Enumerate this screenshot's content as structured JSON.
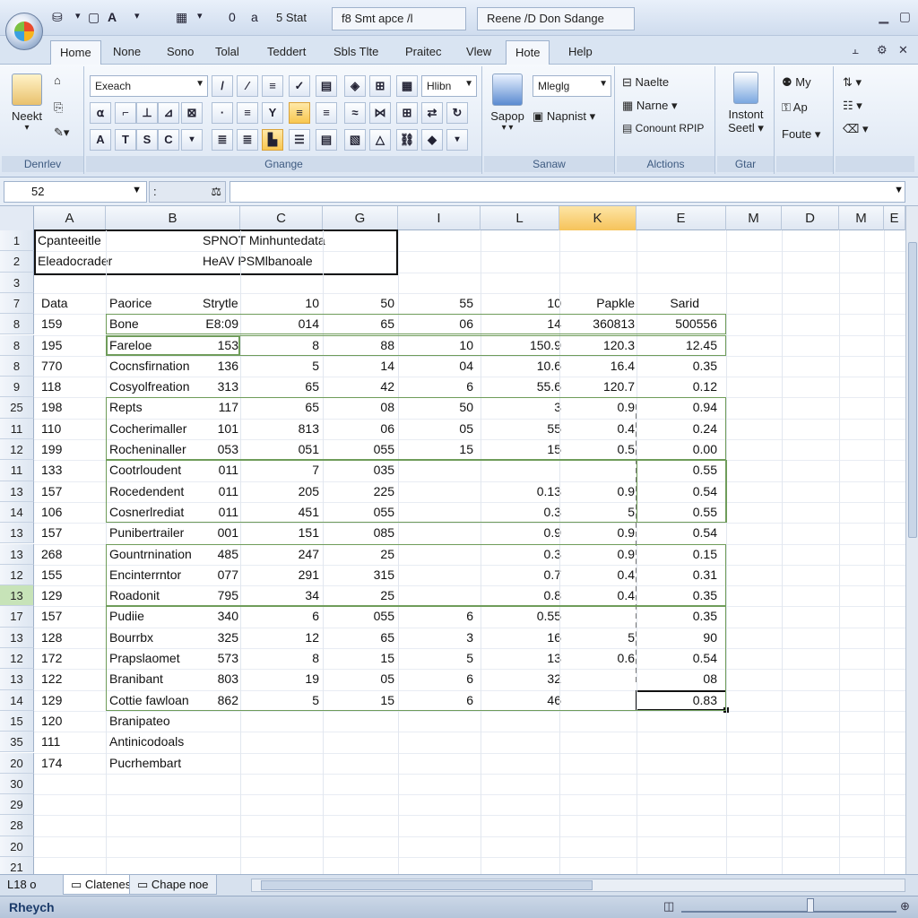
{
  "title_bar": {
    "quick_access": [
      "⇱",
      "A",
      "0",
      "a"
    ],
    "doc_title_1": "5 Stat",
    "doc_title_2": "f8 Smt apce /l",
    "doc_title_3": "Reene /D Don Sdange"
  },
  "tabs": [
    "Home",
    "None",
    "Sono",
    "Tolal",
    "Teddert",
    "Sbls Tlte",
    "Praitec",
    "Vlew",
    "Hote",
    "Help"
  ],
  "active_tab": "Home",
  "ribbon": {
    "clipboard": {
      "paste_label": "Neekt",
      "group_label": "Denrlev"
    },
    "font": {
      "font_name": "Exeach",
      "style_name": "Hlibn",
      "group_label": "Gnange"
    },
    "styles": {
      "combo": "Mleglg",
      "big_label": "Sapop",
      "napnist": "Napnist",
      "group_label": "Sanaw"
    },
    "actions": {
      "items": [
        "Naelte",
        "Narne",
        "Conount RPIP"
      ],
      "group_label": "Alctions"
    },
    "insert": {
      "label_1": "Instont",
      "label_2": "Seetl",
      "group_label": "Gtar"
    },
    "misc": {
      "items": [
        "My",
        "Ap",
        "Foute"
      ]
    }
  },
  "formula_bar": {
    "name_box": "52",
    "formula": ""
  },
  "columns": [
    "A",
    "B",
    "C",
    "G",
    "I",
    "L",
    "K",
    "E",
    "M",
    "D",
    "M",
    "E"
  ],
  "selected_column": "K",
  "row_numbers": [
    "1",
    "2",
    "3",
    "7",
    "8",
    "8",
    "8",
    "9",
    "25",
    "11",
    "12",
    "11",
    "13",
    "14",
    "13",
    "13",
    "12",
    "13",
    "17",
    "13",
    "12",
    "13",
    "14",
    "15",
    "35",
    "20",
    "30",
    "29",
    "28",
    "20",
    "21"
  ],
  "selected_row_index": 17,
  "header_cells": {
    "r1_a": "Cpanteeitle",
    "r1_c": "SPNOT Minhuntedata",
    "r2_a": "Eleadocrader",
    "r2_c": "HeAV PSMlbanoale"
  },
  "table_header": [
    "Data",
    "Paorice",
    "Strytle",
    "10",
    "50",
    "55",
    "10",
    "Papkle",
    "Sarid"
  ],
  "rows": [
    [
      "159",
      "Bone",
      "E8:09",
      "014",
      "65",
      "06",
      "14",
      "360813",
      "500556"
    ],
    [
      "195",
      "Fareloe",
      "153",
      "8",
      "88",
      "10",
      "150.9",
      "120.3",
      "12.45"
    ],
    [
      "770",
      "Cocnsfirnation",
      "136",
      "5",
      "14",
      "04",
      "10.6",
      "16.4",
      "0.35"
    ],
    [
      "118",
      "Cosyolfreation",
      "313",
      "65",
      "42",
      "6",
      "55.6",
      "120.7",
      "0.12"
    ],
    [
      "198",
      "Repts",
      "117",
      "65",
      "08",
      "50",
      "3",
      "0.9",
      "0.94"
    ],
    [
      "110",
      "Cocherimaller",
      "101",
      "813",
      "06",
      "05",
      "55",
      "0.4",
      "0.24"
    ],
    [
      "199",
      "Rocheninaller",
      "053",
      "051",
      "055",
      "15",
      "15",
      "0.5",
      "0.00"
    ],
    [
      "133",
      "Cootrloudent",
      "011",
      "7",
      "035",
      "",
      "",
      "",
      "0.55"
    ],
    [
      "157",
      "Rocedendent",
      "011",
      "205",
      "225",
      "",
      "0.13",
      "0.9",
      "0.54"
    ],
    [
      "106",
      "Cosnerlrediat",
      "011",
      "451",
      "055",
      "",
      "0.3",
      "5",
      "0.55"
    ],
    [
      "157",
      "Punibertrailer",
      "001",
      "151",
      "085",
      "",
      "0.9",
      "0.9",
      "0.54"
    ],
    [
      "268",
      "Gountrnination",
      "485",
      "247",
      "25",
      "",
      "0.3",
      "0.9",
      "0.15"
    ],
    [
      "155",
      "Encinterrntor",
      "077",
      "291",
      "315",
      "",
      "0.7",
      "0.4",
      "0.31"
    ],
    [
      "129",
      "Roadonit",
      "795",
      "34",
      "25",
      "",
      "0.8",
      "0.4",
      "0.35"
    ],
    [
      "157",
      "Pudiie",
      "340",
      "6",
      "055",
      "6",
      "0.55",
      "",
      "0.35"
    ],
    [
      "128",
      "Bourrbx",
      "325",
      "12",
      "65",
      "3",
      "16",
      "5",
      "90"
    ],
    [
      "172",
      "Prapslaomet",
      "573",
      "8",
      "15",
      "5",
      "13",
      "0.6",
      "0.54"
    ],
    [
      "122",
      "Branibant",
      "803",
      "19",
      "05",
      "6",
      "32",
      "",
      "08"
    ],
    [
      "129",
      "Cottie fawloan",
      "862",
      "5",
      "15",
      "6",
      "46",
      "",
      "0.83"
    ],
    [
      "120",
      "Branipateo",
      "",
      "",
      "",
      "",
      "",
      "",
      ""
    ],
    [
      "111",
      "Antinicodoals",
      "",
      "",
      "",
      "",
      "",
      "",
      ""
    ],
    [
      "174",
      "Pucrhembart",
      "",
      "",
      "",
      "",
      "",
      "",
      ""
    ]
  ],
  "sheet_bar": {
    "nav": "L18 o",
    "tabs": [
      "Clatenes",
      "Chape noe"
    ]
  },
  "status_bar": {
    "text": "Rheych"
  },
  "colors": {
    "accent": "#f6c35a",
    "grid_border": "#6f9c5a",
    "ribbon": "#dce6f3"
  }
}
